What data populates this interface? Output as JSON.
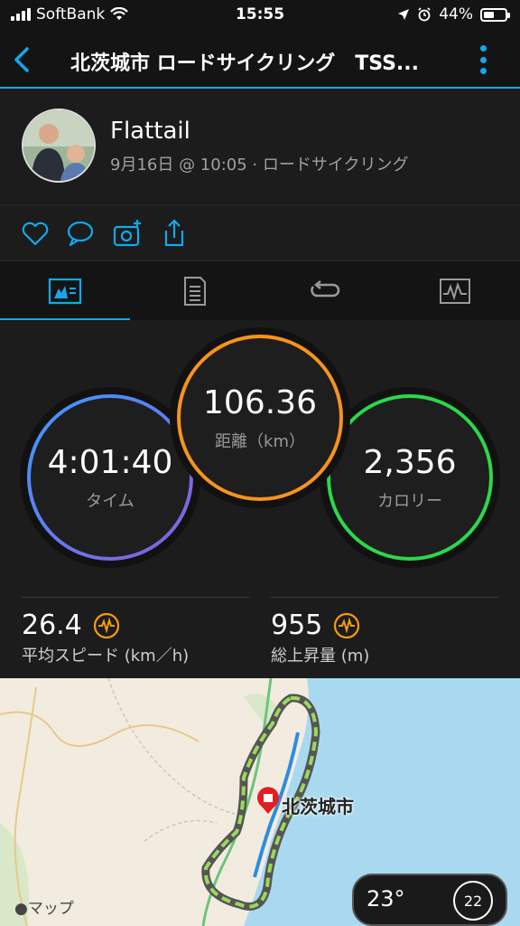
{
  "status_bar": {
    "carrier": "SoftBank",
    "time": "15:55",
    "battery": "44%",
    "battery_level": 0.44
  },
  "nav": {
    "title": "北茨城市 ロードサイクリング　TSS..."
  },
  "profile": {
    "name": "Flattail",
    "meta": "9月16日 @ 10:05 · ロードサイクリング"
  },
  "actions": [
    "heart-icon",
    "comment-icon",
    "add-photo-icon",
    "share-icon"
  ],
  "tabs": [
    "overview-tab",
    "details-tab",
    "laps-tab",
    "charts-tab"
  ],
  "stats": {
    "time": {
      "value": "4:01:40",
      "label": "タイム"
    },
    "distance": {
      "value": "106.36",
      "label": "距離（km）"
    },
    "calories": {
      "value": "2,356",
      "label": "カロリー"
    },
    "avg_speed": {
      "value": "26.4",
      "label": "平均スピード (km／h)"
    },
    "elevation_gain": {
      "value": "955",
      "label": "総上昇量 (m)"
    }
  },
  "map": {
    "place": "北茨城市",
    "attribution": "マップ",
    "weather": {
      "temp": "23°",
      "aqi": "22"
    }
  },
  "colors": {
    "accent": "#11a9ed",
    "time_ring": "#6b8cff",
    "distance_ring": "#f7931e",
    "calorie_ring": "#2bd84a",
    "metric_icon": "#f39c12"
  }
}
